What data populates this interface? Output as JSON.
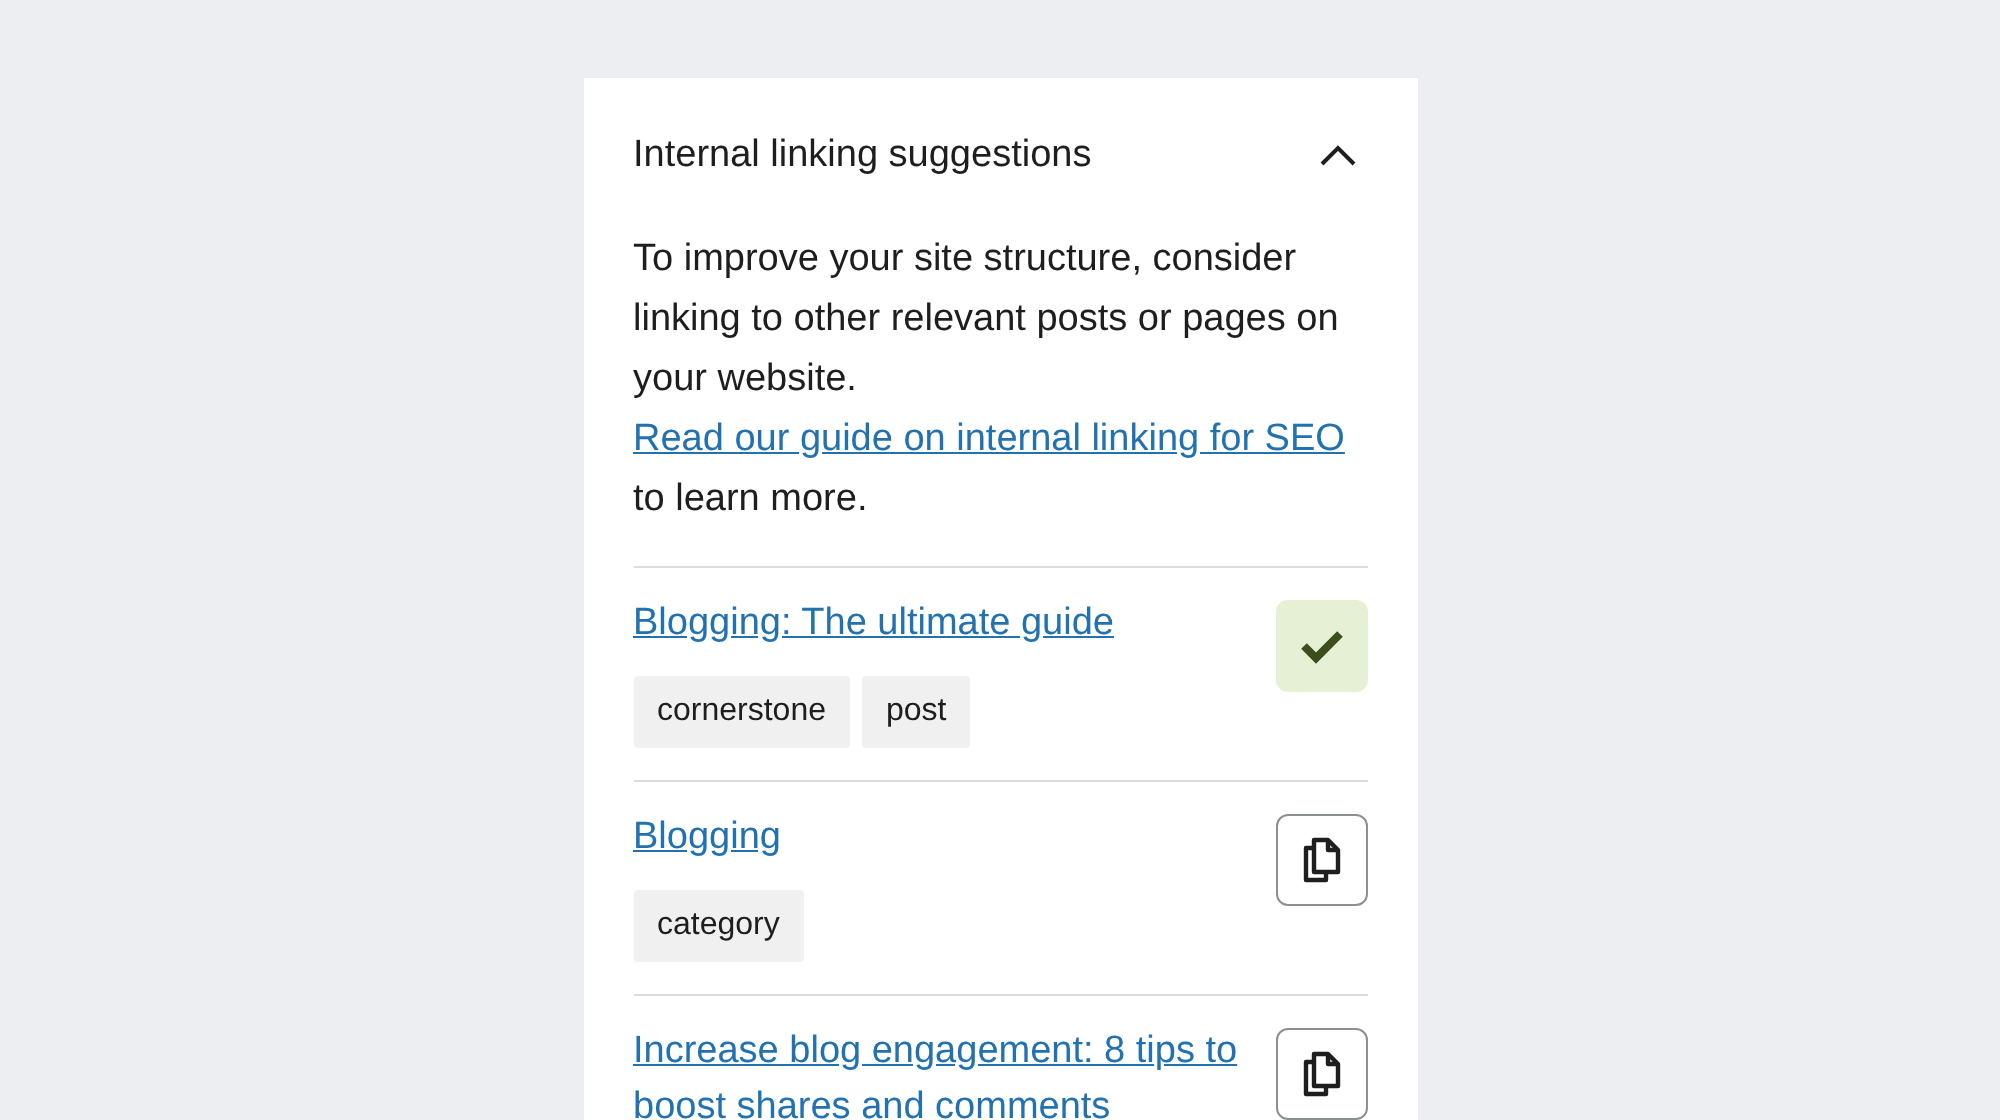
{
  "panel": {
    "title": "Internal linking suggestions",
    "expanded": true,
    "intro": "To improve your site structure, consider linking to other relevant posts or pages on your website.",
    "guide_link": "Read our guide on internal linking for SEO",
    "outro": "to learn more.",
    "suggestions": [
      {
        "title": "Blogging: The ultimate guide",
        "tags": [
          "cornerstone",
          "post"
        ],
        "linked": true
      },
      {
        "title": "Blogging",
        "tags": [
          "category"
        ],
        "linked": false
      },
      {
        "title": "Increase blog engagement: 8 tips to boost shares and comments",
        "linked": false
      }
    ]
  }
}
